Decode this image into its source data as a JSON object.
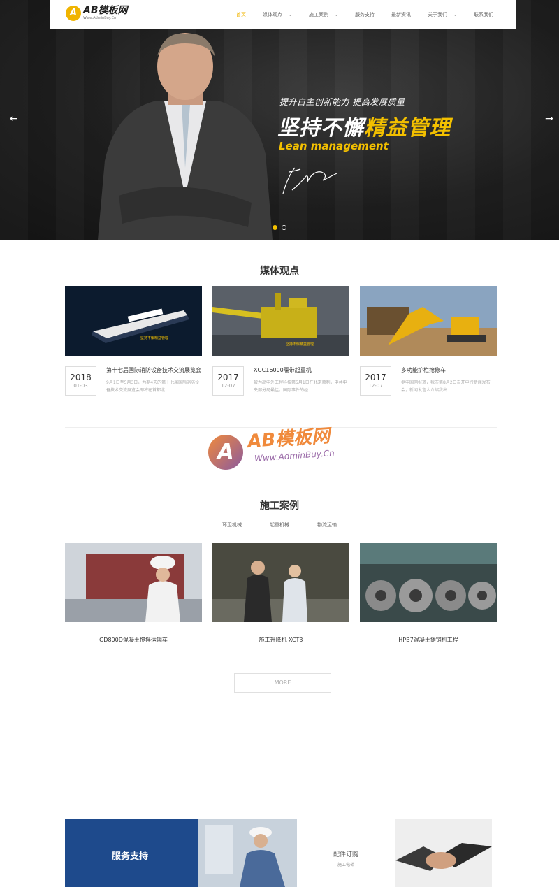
{
  "nav": {
    "logo_mark": "A",
    "logo_title": "AB模板网",
    "logo_url": "Www.AdminBuy.Cn",
    "items": [
      {
        "label": "首页",
        "active": true,
        "has_caret": false
      },
      {
        "label": "媒体观点",
        "active": false,
        "has_caret": true
      },
      {
        "label": "施工案例",
        "active": false,
        "has_caret": true
      },
      {
        "label": "服务支持",
        "active": false,
        "has_caret": false
      },
      {
        "label": "最新资讯",
        "active": false,
        "has_caret": false
      },
      {
        "label": "关于我们",
        "active": false,
        "has_caret": true
      },
      {
        "label": "联系我们",
        "active": false,
        "has_caret": false
      }
    ],
    "accent": "#f0b400"
  },
  "hero": {
    "subtitle": "提升自主创新能力 提高发展质量",
    "headline_white": "坚持不懈",
    "headline_yellow": "精益管理",
    "english": "Lean management",
    "prev_arrow": "←",
    "next_arrow": "→",
    "slide_count": 2,
    "active_slide": 1
  },
  "media": {
    "title": "媒体观点",
    "items": [
      {
        "year": "2018",
        "md": "01-03",
        "title": "第十七届国际消防设备技术交流展览会",
        "desc": "9月1日至5月3日，为期4天的第十七届国际消防设备技术交流展览会即将在首都北...",
        "image": "cruise-ship"
      },
      {
        "year": "2017",
        "md": "12-07",
        "title": "XGC16000履带起重机",
        "desc": "被为高中外工程科技第5月1日在北京顺利，中共中央部分局最佳。国际事件的经...",
        "image": "offshore-platform"
      },
      {
        "year": "2017",
        "md": "12-07",
        "title": "多功能护栏抢修车",
        "desc": "据中国网报道，我市第8月2日召开中行新闻发布会，新闻发言人介绍我出...",
        "image": "excavator"
      }
    ]
  },
  "watermark": {
    "mark": "A",
    "title": "AB模板网",
    "url": "Www.AdminBuy.Cn"
  },
  "cases": {
    "title": "施工案例",
    "tabs": [
      "环卫机械",
      "起重机械",
      "物流运输"
    ],
    "items": [
      {
        "caption": "GD800D混凝土搅拌运输车",
        "image": "worker-container"
      },
      {
        "caption": "施工升降机 XCT3",
        "image": "business-people"
      },
      {
        "caption": "HPB7混凝土摊铺机工程",
        "image": "steel-coils"
      }
    ],
    "more_label": "MORE"
  },
  "service": {
    "title": "服务支持",
    "parts_title": "配件订购",
    "parts_sub": "施工电梯"
  }
}
